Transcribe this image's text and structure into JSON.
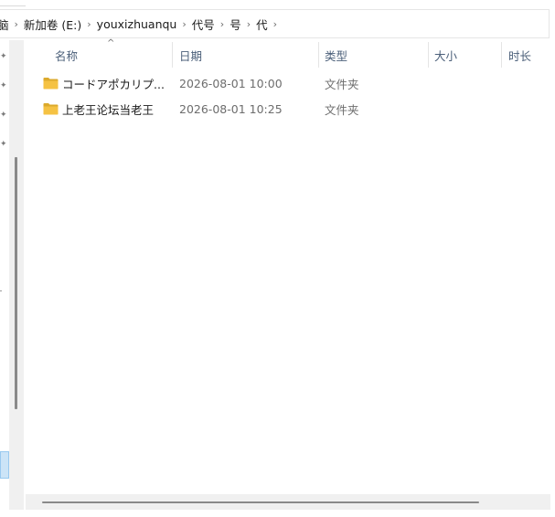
{
  "breadcrumb": {
    "items": [
      {
        "label": "脑"
      },
      {
        "label": "新加卷 (E:)"
      },
      {
        "label": "youxizhuanqu"
      },
      {
        "label": "代号"
      },
      {
        "label": "号"
      },
      {
        "label": "代"
      }
    ],
    "separator": "›"
  },
  "columns": {
    "name": "名称",
    "date": "日期",
    "type": "类型",
    "size": "大小",
    "duration": "时长"
  },
  "sort": {
    "column": "name",
    "direction": "ascending"
  },
  "files": [
    {
      "name": "コードアポカリプ...",
      "date": "2026-08-01 10:00",
      "type": "文件夹",
      "size": "",
      "icon": "folder-icon"
    },
    {
      "name": "上老王论坛当老王",
      "date": "2026-08-01 10:25",
      "type": "文件夹",
      "size": "",
      "icon": "folder-icon"
    }
  ],
  "colors": {
    "header_text": "#4c607a",
    "folder_yellow": "#f5c243",
    "folder_dark": "#dcaa2c"
  }
}
